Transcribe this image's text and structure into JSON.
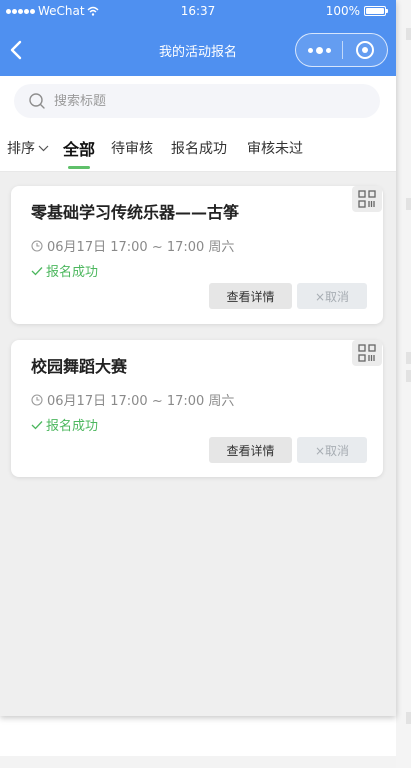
{
  "statusbar": {
    "carrier": "WeChat",
    "time": "16:37",
    "battery": "100%"
  },
  "navbar": {
    "title": "我的活动报名"
  },
  "search": {
    "placeholder": "搜索标题",
    "value": ""
  },
  "tabs": {
    "sort_label": "排序",
    "items": [
      {
        "label": "全部",
        "active": true
      },
      {
        "label": "待审核",
        "active": false
      },
      {
        "label": "报名成功",
        "active": false
      },
      {
        "label": "审核未过",
        "active": false
      }
    ]
  },
  "activities": [
    {
      "title": "零基础学习传统乐器——古筝",
      "time": "06月17日 17:00 ~ 17:00 周六",
      "status": "报名成功",
      "detail_label": "查看详情",
      "cancel_label": "×取消"
    },
    {
      "title": "校园舞蹈大赛",
      "time": "06月17日 17:00 ~ 17:00 周六",
      "status": "报名成功",
      "detail_label": "查看详情",
      "cancel_label": "×取消"
    }
  ],
  "colors": {
    "accent": "#4f90f0",
    "success": "#4cb75e",
    "tab_indicator": "#5fc06a"
  }
}
